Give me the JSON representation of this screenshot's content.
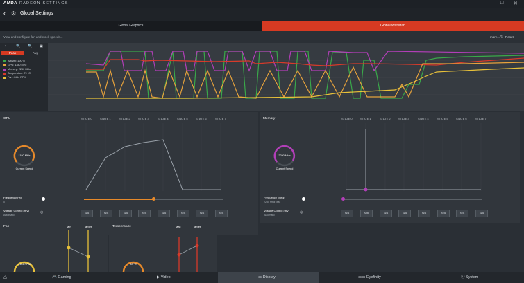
{
  "titlebar": {
    "logo": "AMDA",
    "app_name": "RADEON SETTINGS",
    "min_icon": "□",
    "close_icon": "✕"
  },
  "header": {
    "title": "Global Settings"
  },
  "tabs": [
    {
      "label": "Global Graphics",
      "active": false
    },
    {
      "label": "Global WattMan",
      "active": true
    }
  ],
  "subbar": {
    "description": "View and configure fan and clock speeds...",
    "more": "more...",
    "reset": "Reset"
  },
  "left": {
    "peak_label": "Peak",
    "avg_label": "Avg"
  },
  "legend": [
    {
      "label": "Activity: 100 %",
      "color": "#3aa84a"
    },
    {
      "label": "GPU: 1180 MHz",
      "color": "#e6a23c"
    },
    {
      "label": "Memory: 2250 MHz",
      "color": "#b23eb8"
    },
    {
      "label": "Temperature: 79 °C",
      "color": "#d83a2a"
    },
    {
      "label": "Fan: 4464 RPM",
      "color": "#e8c13a"
    }
  ],
  "gpu": {
    "title": "GPU",
    "states": [
      "STATE 0",
      "STATE 1",
      "STATE 2",
      "STATE 3",
      "STATE 4",
      "STATE 5",
      "STATE 6",
      "STATE 7"
    ],
    "gauge_value": "1180 MHz",
    "gauge_label": "Current Speed",
    "freq_label": "Frequency (%)",
    "freq_value": "0",
    "volt_label": "Voltage Control (mV)",
    "volt_value": "Automatic",
    "na_values": [
      "N/A",
      "N/A",
      "N/A",
      "N/A",
      "N/A",
      "N/A",
      "N/A",
      "N/A"
    ]
  },
  "memory": {
    "title": "Memory",
    "states": [
      "STATE 0",
      "STATE 1",
      "STATE 2",
      "STATE 3",
      "STATE 4",
      "STATE 5",
      "STATE 6",
      "STATE 7"
    ],
    "gauge_value": "2250 MHz",
    "gauge_label": "Current Speed",
    "freq_label": "Frequency (MHz)",
    "freq_value": "2250 MHz Max",
    "volt_label": "Voltage Control (mV)",
    "volt_value": "Automatic",
    "na_values": [
      "N/A",
      "Auto",
      "N/A",
      "N/A",
      "N/A",
      "N/A",
      "N/A",
      "N/A"
    ]
  },
  "fan": {
    "title": "Fan",
    "min_label": "Min",
    "target_label": "Target",
    "gauge_value": "4464 RPM"
  },
  "temperature": {
    "title": "Temperature",
    "max_label": "Max",
    "target_label": "Target",
    "gauge_value": "80 °C"
  },
  "nav": [
    {
      "label": "Gaming",
      "icon": "gamepad-icon",
      "active": false
    },
    {
      "label": "Video",
      "icon": "play-icon",
      "active": false
    },
    {
      "label": "Display",
      "icon": "monitor-icon",
      "active": true
    },
    {
      "label": "Eyefinity",
      "icon": "eyefinity-icon",
      "active": false
    },
    {
      "label": "System",
      "icon": "info-icon",
      "active": false
    }
  ]
}
